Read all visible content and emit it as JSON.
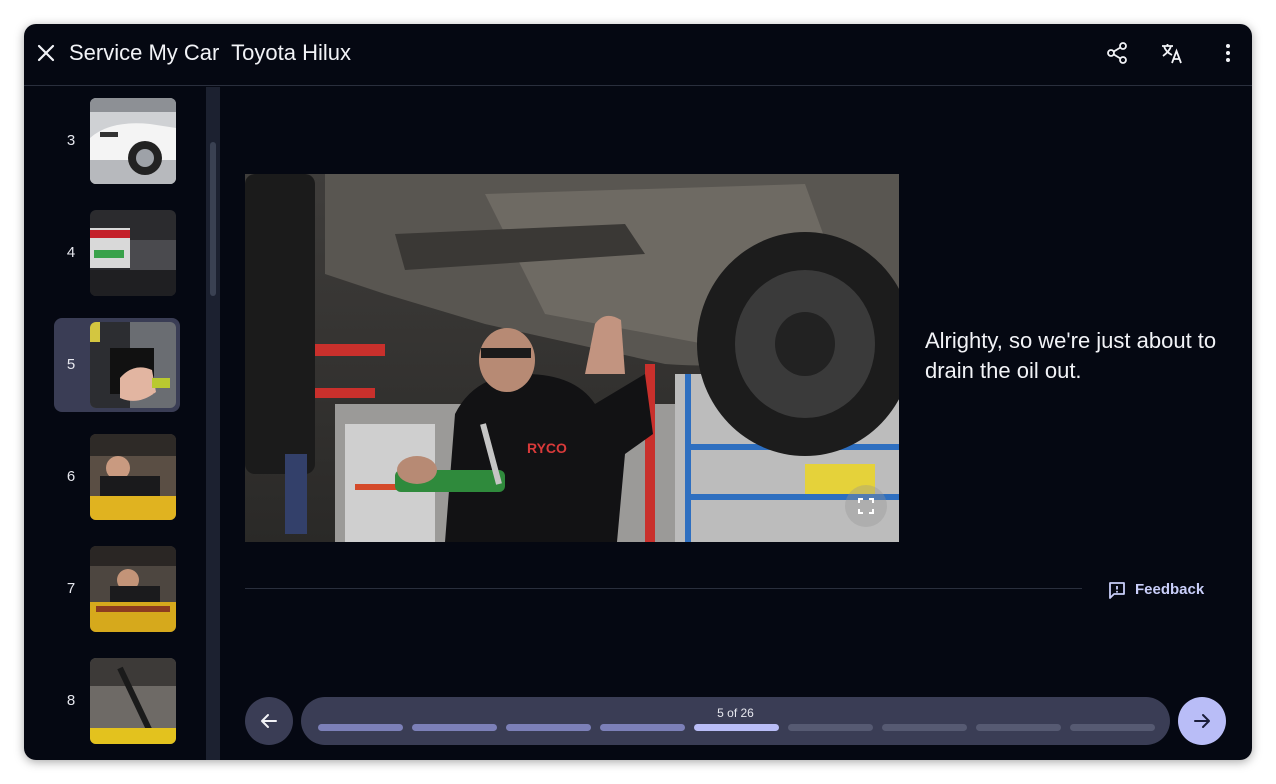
{
  "header": {
    "title": "Service My Car  Toyota Hilux",
    "icons": [
      "close-icon",
      "share-icon",
      "translate-icon",
      "more-vert-icon"
    ]
  },
  "sidebar": {
    "items": [
      {
        "number": "3",
        "active": false
      },
      {
        "number": "4",
        "active": false
      },
      {
        "number": "5",
        "active": true
      },
      {
        "number": "6",
        "active": false
      },
      {
        "number": "7",
        "active": false
      },
      {
        "number": "8",
        "active": false
      }
    ]
  },
  "step": {
    "caption": "Alrighty, so we're just about to drain the oil out.",
    "image_text": "RYCO"
  },
  "feedback": {
    "label": "Feedback"
  },
  "progress": {
    "label": "5 of 26",
    "current": 5,
    "total": 26,
    "segment_states": [
      "done",
      "done",
      "done",
      "done",
      "current",
      "todo",
      "todo",
      "todo",
      "todo"
    ]
  },
  "colors": {
    "background": "#050812",
    "surface": "#3a3d55",
    "accent": "#b9bdf7",
    "segment_done": "#7c80b8",
    "segment_current": "#b9bdf7",
    "segment_todo": "#565a72"
  }
}
